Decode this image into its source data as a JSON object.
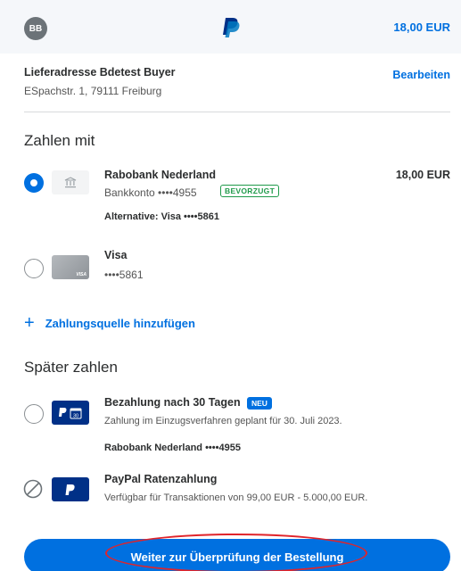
{
  "header": {
    "avatar_initials": "BB",
    "total": "18,00 EUR"
  },
  "address": {
    "title": "Lieferadresse Bdetest Buyer",
    "line": "ESpachstr. 1, 79111 Freiburg",
    "edit_label": "Bearbeiten"
  },
  "pay_with": {
    "title": "Zahlen mit",
    "methods": [
      {
        "name": "Rabobank Nederland",
        "detail": "Bankkonto ••••4955",
        "badge": "BEVORZUGT",
        "amount": "18,00 EUR",
        "alternative": "Alternative: Visa ••••5861",
        "selected": true,
        "icon": "bank-icon"
      },
      {
        "name": "Visa",
        "detail": "••••5861",
        "card_brand": "VISA",
        "selected": false,
        "icon": "card-icon"
      }
    ],
    "add_source": "Zahlungsquelle hinzufügen"
  },
  "pay_later": {
    "title": "Später zahlen",
    "options": [
      {
        "name": "Bezahlung nach 30 Tagen",
        "badge": "NEU",
        "detail": "Zahlung im Einzugsverfahren geplant für 30. Juli 2023.",
        "source": "Rabobank Nederland ••••4955",
        "icon": "paypal-calendar-icon"
      },
      {
        "name": "PayPal Ratenzahlung",
        "detail": "Verfügbar für Transaktionen von 99,00 EUR - 5.000,00 EUR.",
        "disabled": true,
        "icon": "paypal-icon"
      }
    ]
  },
  "cta": {
    "label": "Weiter zur Überprüfung der Bestellung"
  },
  "colors": {
    "primary": "#0070e0",
    "badge_green": "#1f9a4a",
    "annotation_red": "#e0242b",
    "paypal_navy": "#003087"
  }
}
